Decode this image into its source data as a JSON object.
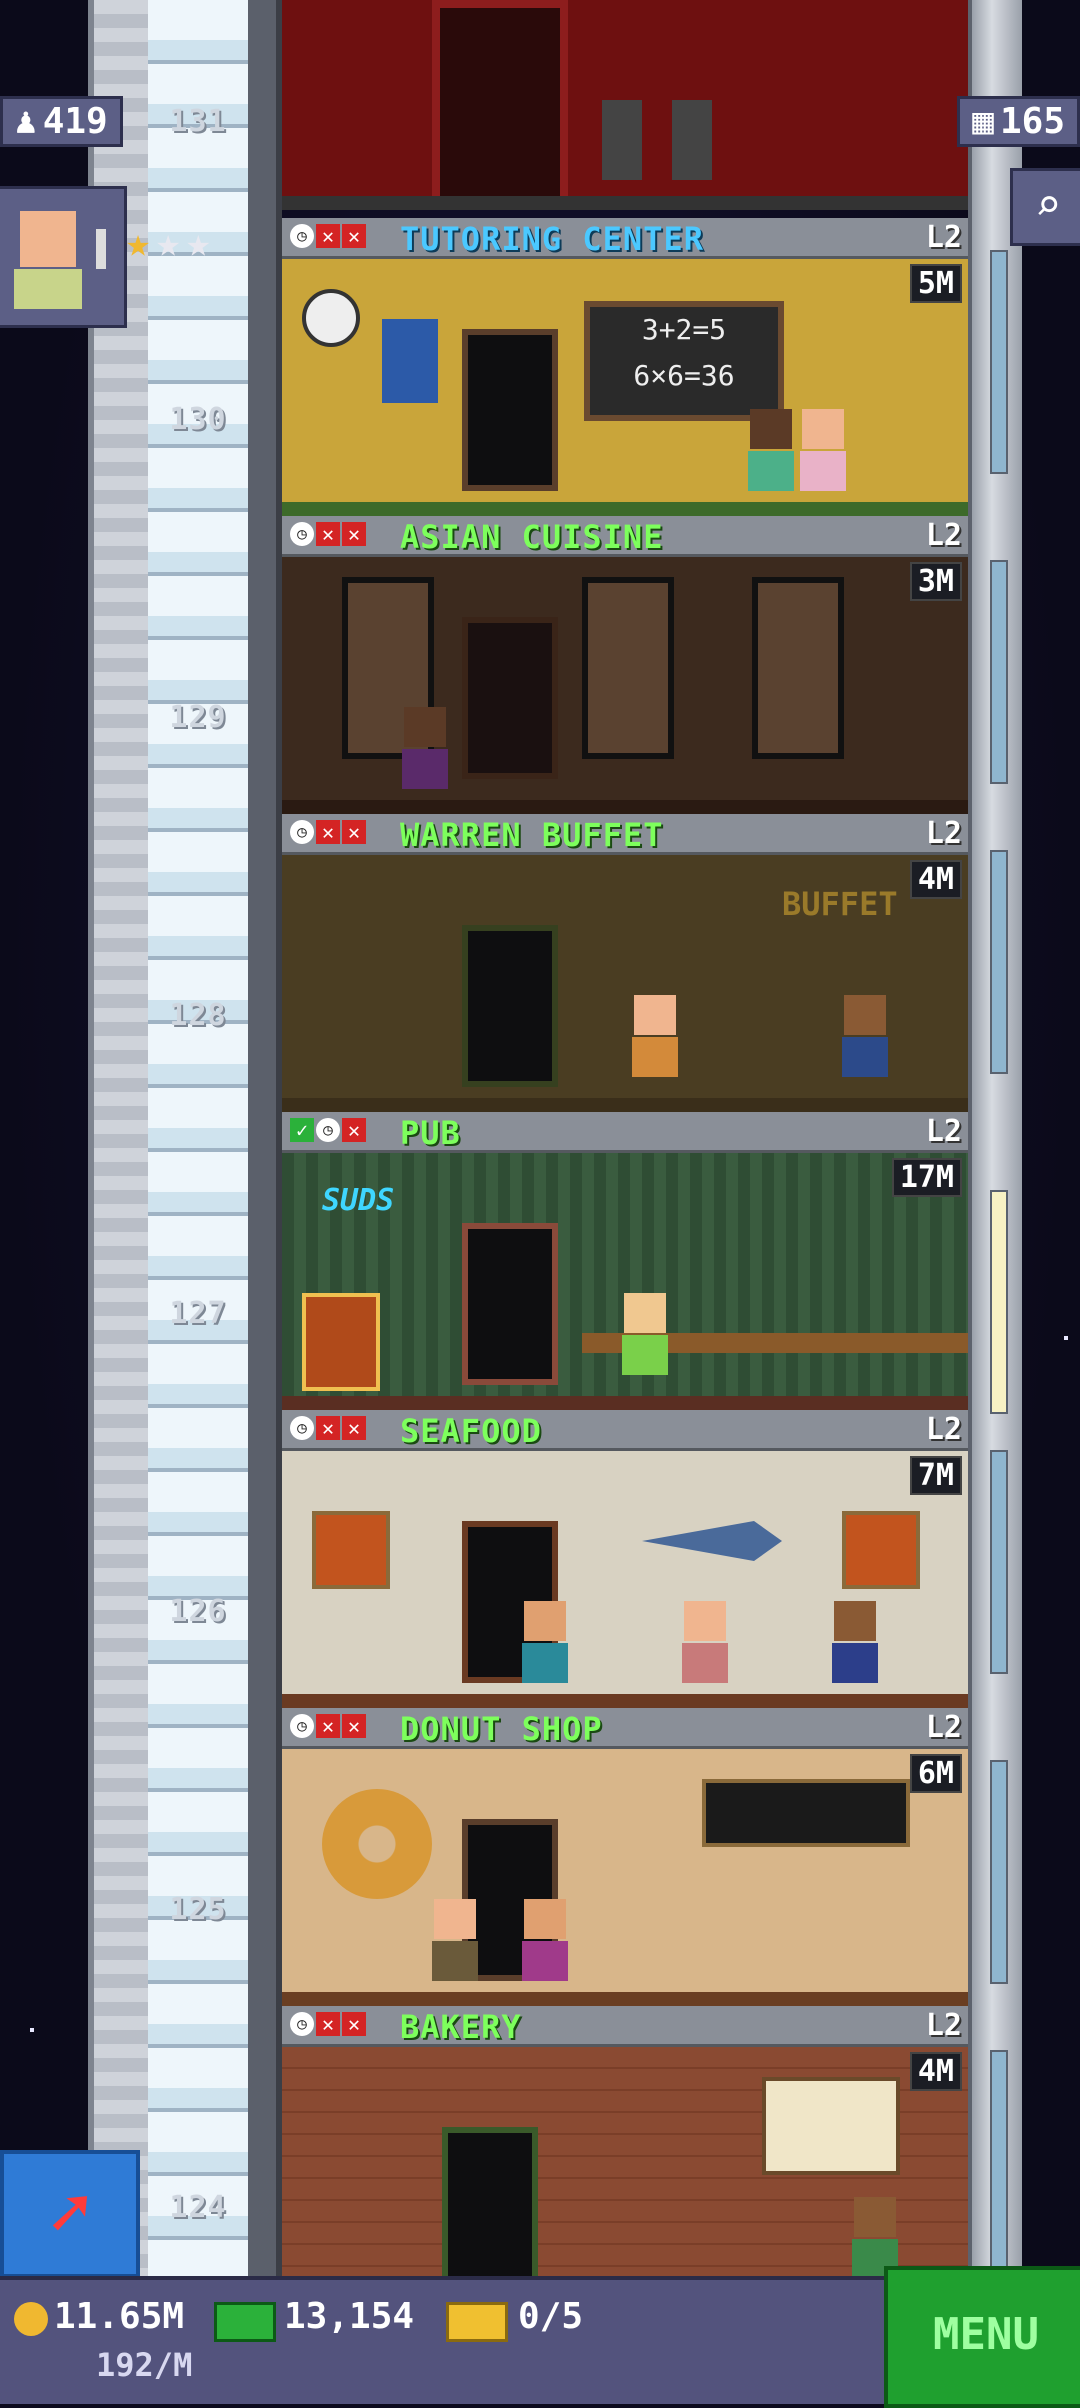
{
  "hud": {
    "population": "419",
    "bux": "165",
    "coins": "11.65M",
    "coin_rate": "192/M",
    "cash": "13,154",
    "tickets": "0/5",
    "menu_label": "MENU"
  },
  "floor_numbers": [
    "131",
    "130",
    "129",
    "128",
    "127",
    "126",
    "125",
    "124"
  ],
  "floors": [
    {
      "name": "TUTORING CENTER",
      "level": "L2",
      "income": "5M",
      "color": "blue",
      "status": [
        "clock",
        "x",
        "x"
      ]
    },
    {
      "name": "ASIAN CUISINE",
      "level": "L2",
      "income": "3M",
      "color": "green",
      "status": [
        "clock",
        "x",
        "x"
      ]
    },
    {
      "name": "WARREN BUFFET",
      "level": "L2",
      "income": "4M",
      "color": "green",
      "status": [
        "clock",
        "x",
        "x"
      ]
    },
    {
      "name": "PUB",
      "level": "L2",
      "income": "17M",
      "color": "green",
      "status": [
        "check",
        "clock",
        "x"
      ]
    },
    {
      "name": "SEAFOOD",
      "level": "L2",
      "income": "7M",
      "color": "green",
      "status": [
        "clock",
        "x",
        "x"
      ]
    },
    {
      "name": "DONUT SHOP",
      "level": "L2",
      "income": "6M",
      "color": "green",
      "status": [
        "clock",
        "x",
        "x"
      ]
    },
    {
      "name": "BAKERY",
      "level": "L2",
      "income": "4M",
      "color": "green",
      "status": [
        "clock",
        "x",
        "x"
      ]
    }
  ],
  "decor_text": {
    "chalkboard_line1": "3+2=5",
    "chalkboard_line2": "6×6=36",
    "buffet_sign": "BUFFET",
    "pub_sign": "SUDS"
  },
  "icons": {
    "population": "person-icon",
    "bux": "building-icon",
    "search": "magnifier-icon",
    "coin": "coin-icon",
    "cash": "cash-icon",
    "ticket": "ticket-icon",
    "raise": "arrow-up-right-icon"
  }
}
